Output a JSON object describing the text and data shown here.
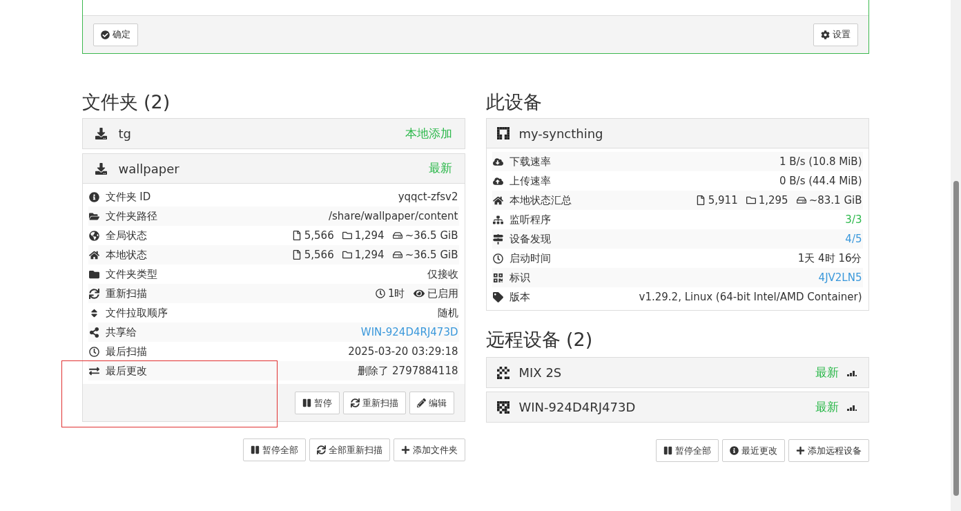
{
  "top_panel": {
    "buttons": [
      {
        "label": "确定"
      },
      {
        "label": "设置"
      }
    ]
  },
  "folders": {
    "title": "文件夹 (2)",
    "items": [
      {
        "name": "tg",
        "status": "本地添加",
        "expanded": false
      },
      {
        "name": "wallpaper",
        "status": "最新",
        "expanded": true,
        "rows": [
          {
            "kind": "text",
            "label": "文件夹 ID",
            "value": "yqqct-zfsv2"
          },
          {
            "kind": "text",
            "label": "文件夹路径",
            "value": "/share/wallpaper/content"
          },
          {
            "kind": "stats",
            "label": "全局状态",
            "stats": [
              "5,566",
              "1,294",
              "~36.5 GiB"
            ]
          },
          {
            "kind": "stats",
            "label": "本地状态",
            "stats": [
              "5,566",
              "1,294",
              "~36.5 GiB"
            ]
          },
          {
            "kind": "text",
            "label": "文件夹类型",
            "value": "仅接收"
          },
          {
            "kind": "rescan",
            "label": "重新扫描",
            "interval": "1时",
            "watcher": "已启用"
          },
          {
            "kind": "text",
            "label": "文件拉取顺序",
            "value": "随机"
          },
          {
            "kind": "link",
            "label": "共享给",
            "value": "WIN-924D4RJ473D"
          },
          {
            "kind": "text",
            "label": "最后扫描",
            "value": "2025-03-20 03:29:18"
          },
          {
            "kind": "text",
            "label": "最后更改",
            "value": "删除了 2797884118"
          }
        ],
        "buttons": [
          {
            "label": "暂停"
          },
          {
            "label": "重新扫描"
          },
          {
            "label": "编辑"
          }
        ]
      }
    ],
    "buttons": [
      {
        "label": "暂停全部"
      },
      {
        "label": "全部重新扫描"
      },
      {
        "label": "添加文件夹"
      }
    ]
  },
  "this_device": {
    "title": "此设备",
    "name": "my-syncthing",
    "rows": [
      {
        "kind": "text",
        "label": "下载速率",
        "value": "1 B/s (10.8 MiB)"
      },
      {
        "kind": "text",
        "label": "上传速率",
        "value": "0 B/s (44.4 MiB)"
      },
      {
        "kind": "stats",
        "label": "本地状态汇总",
        "stats": [
          "5,911",
          "1,295",
          "~83.1 GiB"
        ]
      },
      {
        "kind": "success",
        "label": "监听程序",
        "value": "3/3"
      },
      {
        "kind": "link",
        "label": "设备发现",
        "value": "4/5"
      },
      {
        "kind": "text",
        "label": "启动时间",
        "value": "1天 4时 16分"
      },
      {
        "kind": "link",
        "label": "标识",
        "value": "4JV2LN5"
      },
      {
        "kind": "text",
        "label": "版本",
        "value": "v1.29.2, Linux (64-bit Intel/AMD Container)"
      }
    ]
  },
  "remote_devices": {
    "title": "远程设备 (2)",
    "items": [
      {
        "name": "MIX 2S",
        "status": "最新"
      },
      {
        "name": "WIN-924D4RJ473D",
        "status": "最新"
      }
    ],
    "buttons": [
      {
        "label": "暂停全部"
      },
      {
        "label": "最近更改"
      },
      {
        "label": "添加远程设备"
      }
    ]
  }
}
